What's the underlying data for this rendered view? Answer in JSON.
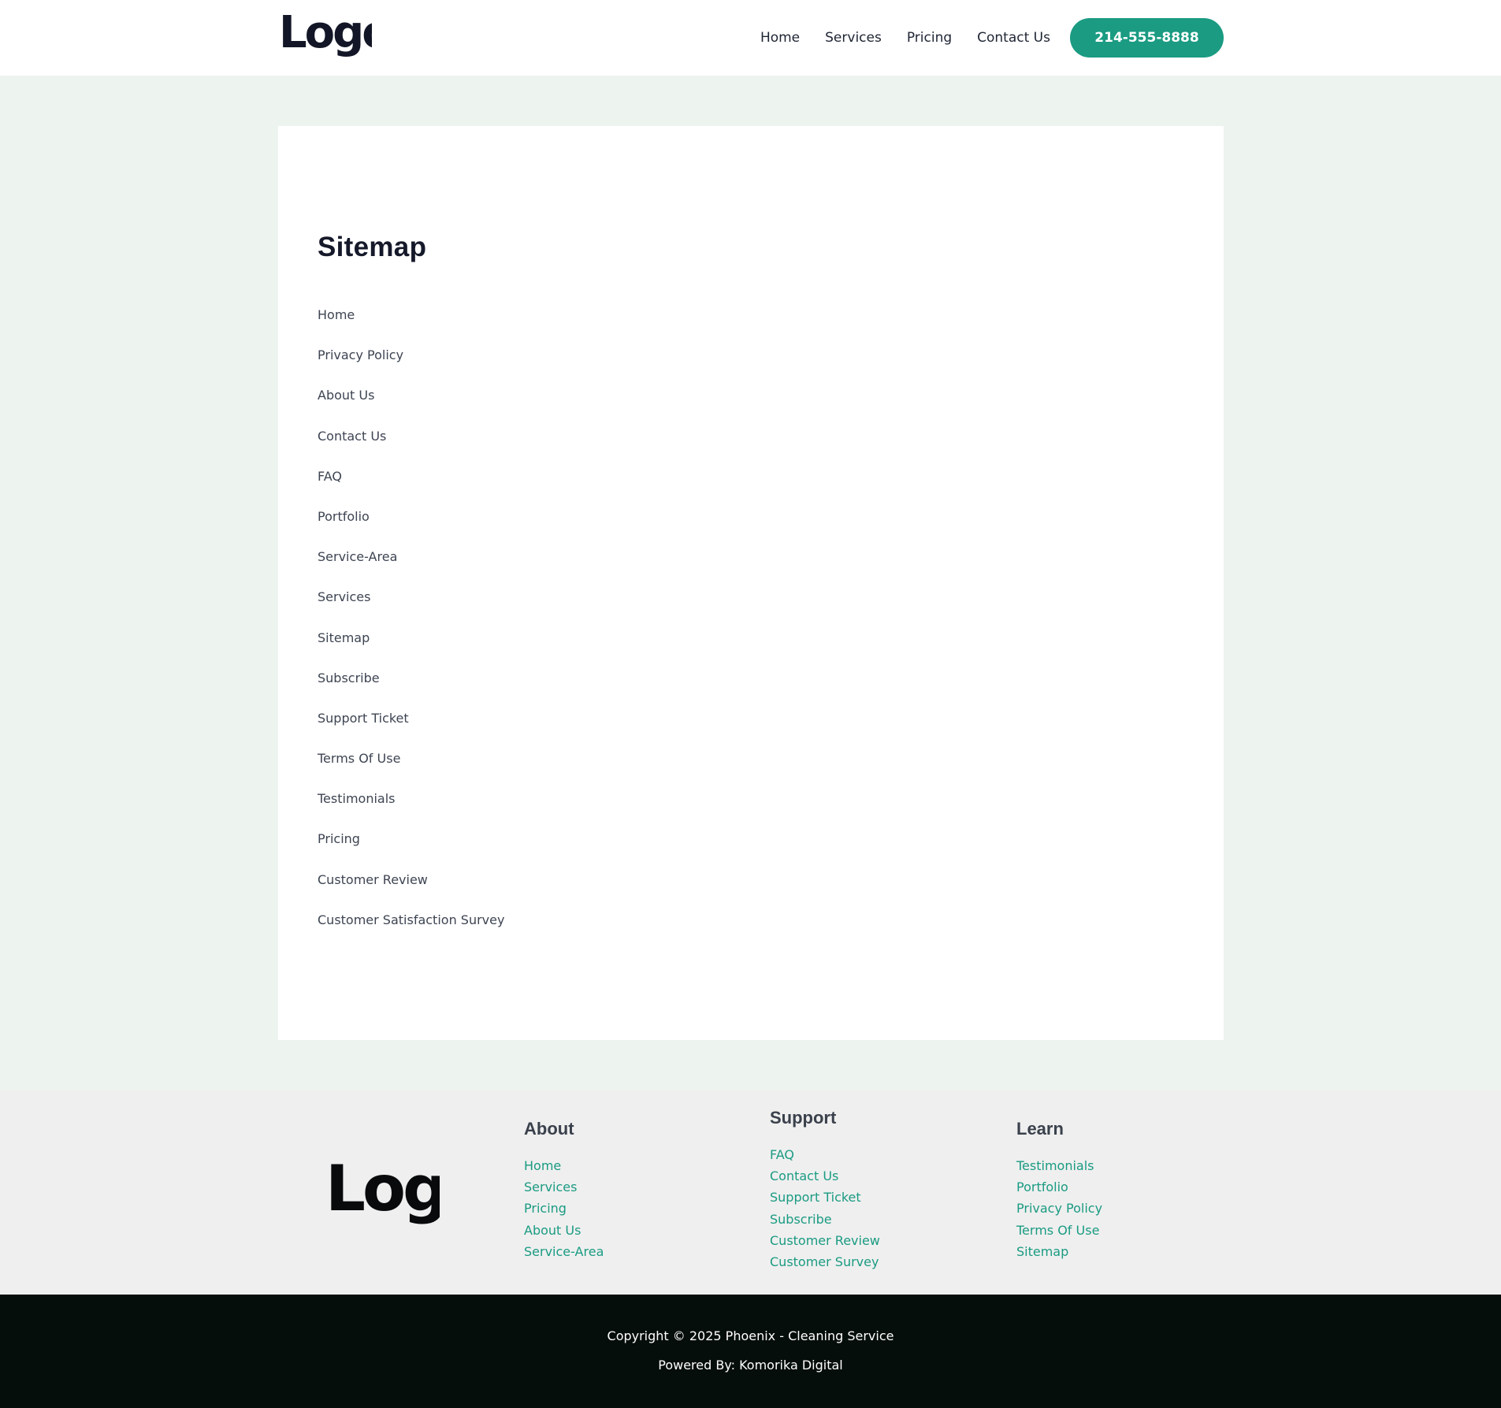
{
  "header": {
    "logo_text": "Logo",
    "nav": [
      {
        "label": "Home"
      },
      {
        "label": "Services"
      },
      {
        "label": "Pricing"
      },
      {
        "label": "Contact Us"
      }
    ],
    "cta_label": "214-555-8888"
  },
  "main": {
    "title": "Sitemap",
    "links": [
      {
        "label": "Home"
      },
      {
        "label": "Privacy Policy"
      },
      {
        "label": "About Us"
      },
      {
        "label": "Contact Us"
      },
      {
        "label": "FAQ"
      },
      {
        "label": "Portfolio"
      },
      {
        "label": "Service-Area"
      },
      {
        "label": "Services"
      },
      {
        "label": "Sitemap"
      },
      {
        "label": "Subscribe"
      },
      {
        "label": "Support Ticket"
      },
      {
        "label": "Terms Of Use"
      },
      {
        "label": "Testimonials"
      },
      {
        "label": "Pricing"
      },
      {
        "label": "Customer Review"
      },
      {
        "label": "Customer Satisfaction Survey"
      }
    ]
  },
  "footer": {
    "logo_text": "Logo",
    "columns": [
      {
        "heading": "About",
        "links": [
          {
            "label": "Home"
          },
          {
            "label": "Services"
          },
          {
            "label": "Pricing"
          },
          {
            "label": "About Us"
          },
          {
            "label": "Service-Area"
          }
        ]
      },
      {
        "heading": "Support",
        "links": [
          {
            "label": "FAQ"
          },
          {
            "label": "Contact Us"
          },
          {
            "label": "Support Ticket"
          },
          {
            "label": "Subscribe"
          },
          {
            "label": "Customer Review"
          },
          {
            "label": "Customer Survey"
          }
        ]
      },
      {
        "heading": "Learn",
        "links": [
          {
            "label": "Testimonials"
          },
          {
            "label": "Portfolio"
          },
          {
            "label": "Privacy Policy"
          },
          {
            "label": "Terms Of Use"
          },
          {
            "label": "Sitemap"
          }
        ]
      }
    ],
    "copyright": "Copyright © 2025 Phoenix - Cleaning Service",
    "powered_by": "Powered By: Komorika Digital"
  },
  "colors": {
    "accent": "#1a9b82",
    "page_bg": "#edf3ee",
    "footer_bg": "#efefef",
    "footer_bottom_bg": "#060e0b",
    "heading": "#15192a"
  }
}
